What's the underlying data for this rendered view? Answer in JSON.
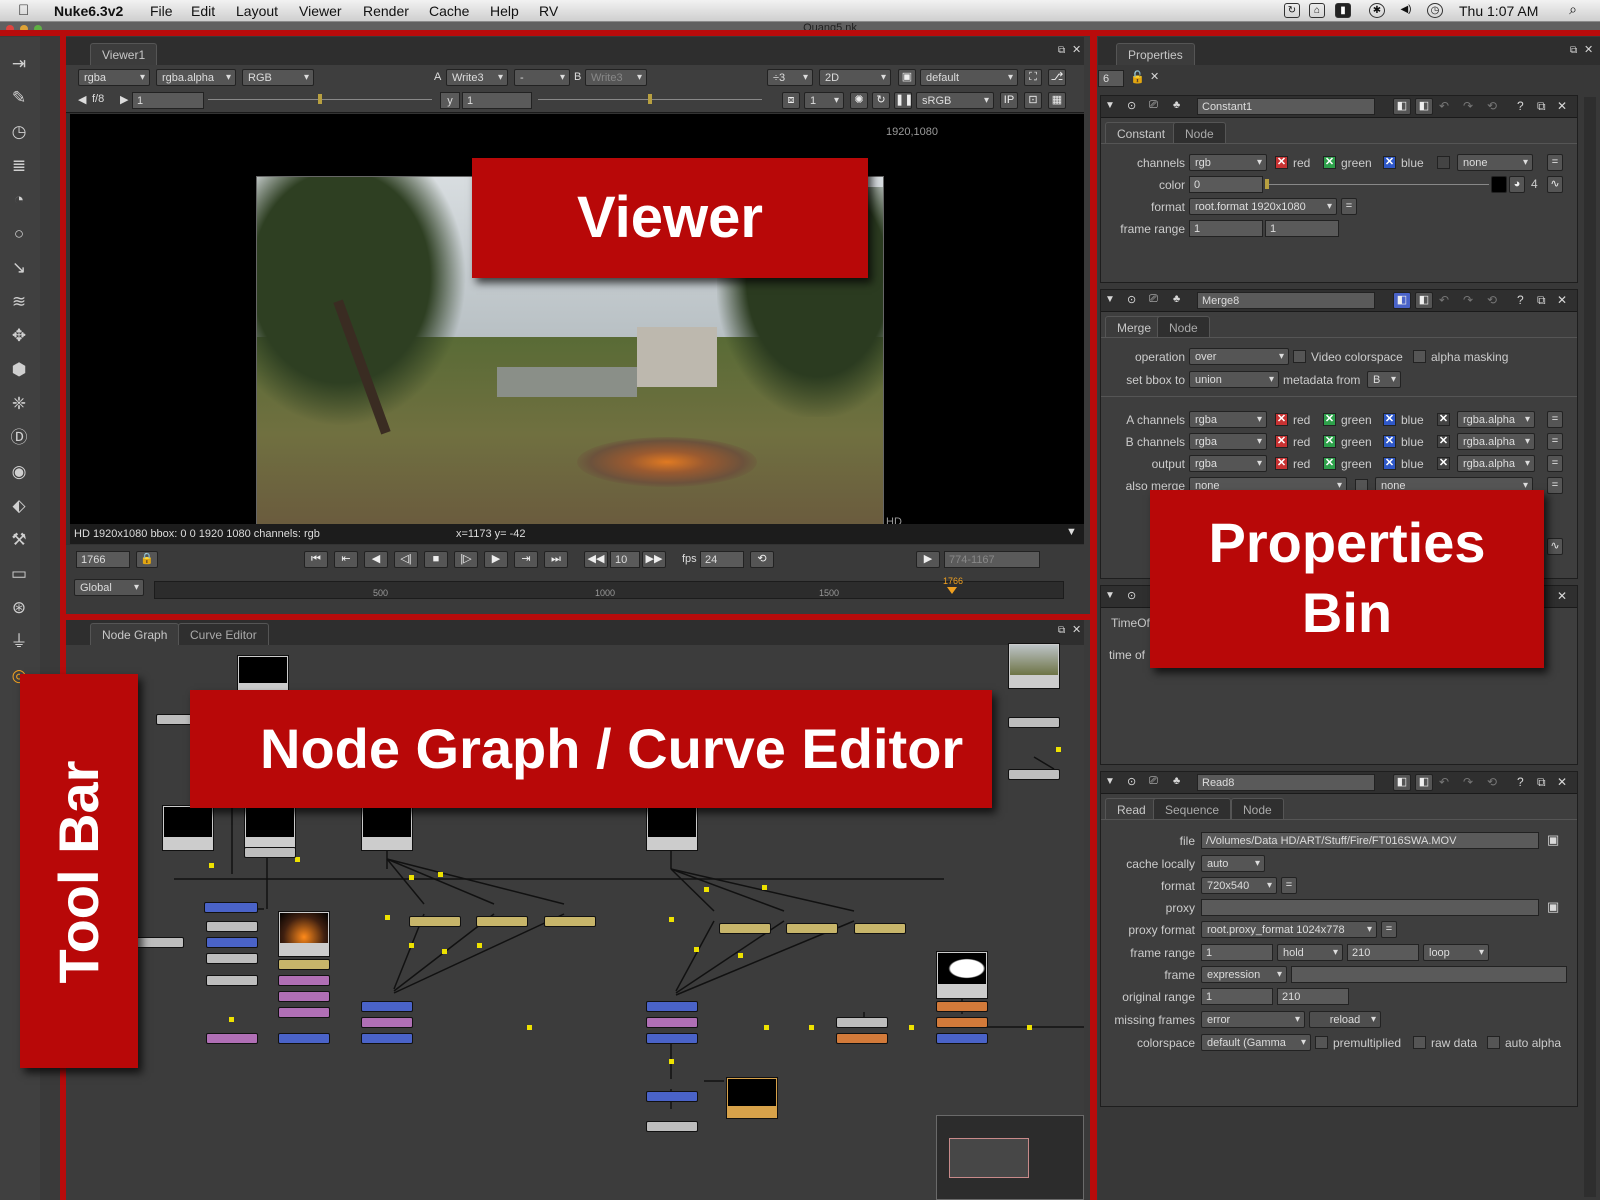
{
  "menubar": {
    "app": "Nuke6.3v2",
    "items": [
      "File",
      "Edit",
      "Layout",
      "Viewer",
      "Render",
      "Cache",
      "Help",
      "RV"
    ],
    "clock": "Thu 1:07 AM"
  },
  "window": {
    "title": "Quang5.nk"
  },
  "overlays": {
    "viewer": "Viewer",
    "properties_line1": "Properties",
    "properties_line2": "Bin",
    "nodegraph": "Node Graph / Curve Editor",
    "toolbar": "Tool Bar"
  },
  "viewer": {
    "tab": "Viewer1",
    "channels": "rgba",
    "alpha": "rgba.alpha",
    "colorspace_view": "RGB",
    "a_label": "A",
    "a_input": "Write3",
    "a_op": "-",
    "b_label": "B",
    "b_input": "Write3",
    "zoom": "÷3",
    "mode": "2D",
    "lut_default": "default",
    "fstop": "f/8",
    "gain": "1",
    "gamma_label": "y",
    "gamma": "1",
    "proxy_level": "1",
    "lut": "sRGB",
    "format_label": "1920,1080",
    "hd_label": "HD",
    "info": "HD 1920x1080 bbox: 0 0 1920 1080 channels: rgb",
    "coords": "x=1173 y= -42",
    "frame": "1766",
    "step": "10",
    "fps_label": "fps",
    "fps": "24",
    "range": "774-1167",
    "global": "Global",
    "timeline_ticks": [
      "500",
      "1000",
      "1500"
    ],
    "timeline_marker": "1766"
  },
  "properties": {
    "tab": "Properties",
    "max_panels": "6",
    "constant": {
      "name": "Constant1",
      "tabs": [
        "Constant",
        "Node"
      ],
      "channels_label": "channels",
      "channels": "rgb",
      "red": "red",
      "green": "green",
      "blue": "blue",
      "none": "none",
      "color_label": "color",
      "color": "0",
      "color_count": "4",
      "format_label": "format",
      "format": "root.format 1920x1080",
      "frame_range_label": "frame range",
      "frame_start": "1",
      "frame_end": "1"
    },
    "merge": {
      "name": "Merge8",
      "tabs": [
        "Merge",
        "Node"
      ],
      "operation_label": "operation",
      "operation": "over",
      "video_colorspace": "Video colorspace",
      "alpha_masking": "alpha masking",
      "bbox_label": "set bbox to",
      "bbox": "union",
      "metadata_label": "metadata from",
      "metadata": "B",
      "a_channels_label": "A channels",
      "b_channels_label": "B channels",
      "output_label": "output",
      "also_merge_label": "also merge",
      "channels": "rgba",
      "alpha": "rgba.alpha",
      "also_merge": "none"
    },
    "timeoffset": {
      "tab": "TimeOf",
      "label": "time of"
    },
    "read": {
      "name": "Read8",
      "tabs": [
        "Read",
        "Sequence",
        "Node"
      ],
      "file_label": "file",
      "file": "/Volumes/Data HD/ART/Stuff/Fire/FT016SWA.MOV",
      "cache_label": "cache locally",
      "cache": "auto",
      "format_label": "format",
      "format": "720x540",
      "proxy_label": "proxy",
      "proxy_format_label": "proxy format",
      "proxy_format": "root.proxy_format 1024x778",
      "frame_range_label": "frame range",
      "range_start": "1",
      "before": "hold",
      "range_end": "210",
      "after": "loop",
      "frame_label": "frame",
      "frame_mode": "expression",
      "original_range_label": "original range",
      "orig_start": "1",
      "orig_end": "210",
      "missing_label": "missing frames",
      "missing": "error",
      "reload": "reload",
      "colorspace_label": "colorspace",
      "colorspace": "default (Gamma",
      "premultiplied": "premultiplied",
      "raw_data": "raw data",
      "auto_alpha": "auto alpha"
    }
  },
  "nodegraph": {
    "tabs": [
      "Node Graph",
      "Curve Editor"
    ]
  },
  "colors": {
    "overlay_red": "#b80808",
    "merge_blue": "#4a63c8",
    "grade_purple": "#b06fb5",
    "transform_tan": "#c7b56a",
    "read_orange": "#d27a3a",
    "noop_gray": "#bdbdbd"
  }
}
